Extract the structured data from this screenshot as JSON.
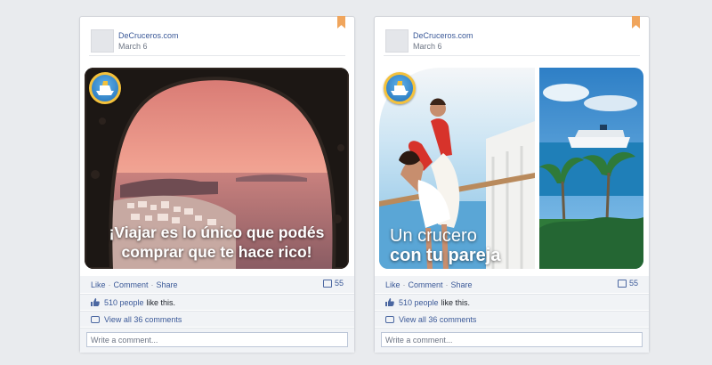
{
  "posts": [
    {
      "page_name": "DeCruceros.com",
      "date": "March 6",
      "caption": "¡Viajar es lo único que podés comprar que te hace rico!",
      "caption_line1": "¡Viajar es lo único que podés",
      "caption_line2": "comprar que te hace rico!",
      "actions": {
        "like": "Like",
        "comment": "Comment",
        "share": "Share",
        "separator": "·"
      },
      "comment_count": "55",
      "likes_count": "510 people",
      "likes_suffix": "like this.",
      "view_comments": "View all 36 comments",
      "comment_placeholder": "Write a comment..."
    },
    {
      "page_name": "DeCruceros.com",
      "date": "March 6",
      "caption_line1": "Un crucero",
      "caption_line2": "con tu pareja",
      "actions": {
        "like": "Like",
        "comment": "Comment",
        "share": "Share",
        "separator": "·"
      },
      "comment_count": "55",
      "likes_count": "510 people",
      "likes_suffix": "like this.",
      "view_comments": "View all 36 comments",
      "comment_placeholder": "Write a comment..."
    }
  ],
  "colors": {
    "link": "#3b5998",
    "bookmark": "#f0a55c",
    "background": "#e9ebee"
  },
  "icons": [
    "bookmark-icon",
    "cruise-logo",
    "comment-count-icon",
    "like-thumb-icon",
    "comments-bubble-icon"
  ]
}
